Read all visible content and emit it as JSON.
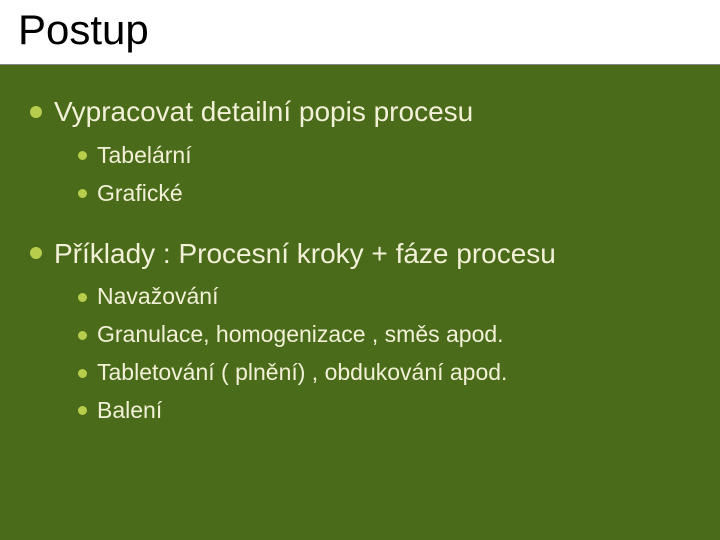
{
  "title": "Postup",
  "items": [
    {
      "text": "Vypracovat detailní popis procesu",
      "subs": [
        {
          "text": "Tabelární"
        },
        {
          "text": "Grafické"
        }
      ]
    },
    {
      "text": "Příklady : Procesní kroky +  fáze procesu",
      "subs": [
        {
          "text": "Navažování"
        },
        {
          "text": "Granulace, homogenizace , směs apod."
        },
        {
          "text": "Tabletování ( plnění) , obdukování apod."
        },
        {
          "text": "Balení"
        }
      ]
    }
  ]
}
